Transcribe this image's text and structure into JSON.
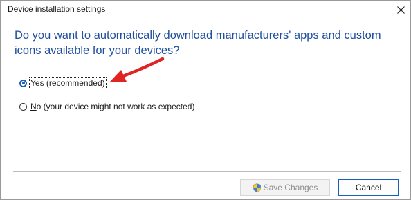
{
  "window": {
    "title": "Device installation settings",
    "close_icon": "close-icon"
  },
  "question": "Do you want to automatically download manufacturers' apps and custom icons available for your devices?",
  "options": [
    {
      "mnemonic": "Y",
      "rest": "es (recommended)",
      "selected": true
    },
    {
      "mnemonic": "N",
      "rest": "o (your device might not work as expected)",
      "selected": false
    }
  ],
  "buttons": {
    "save_label": "Save Changes",
    "save_enabled": false,
    "save_icon": "uac-shield-icon",
    "cancel_label": "Cancel"
  },
  "colors": {
    "accent": "#1a5fb4",
    "question_text": "#1f4e9e",
    "annotation_arrow": "#e02424"
  }
}
